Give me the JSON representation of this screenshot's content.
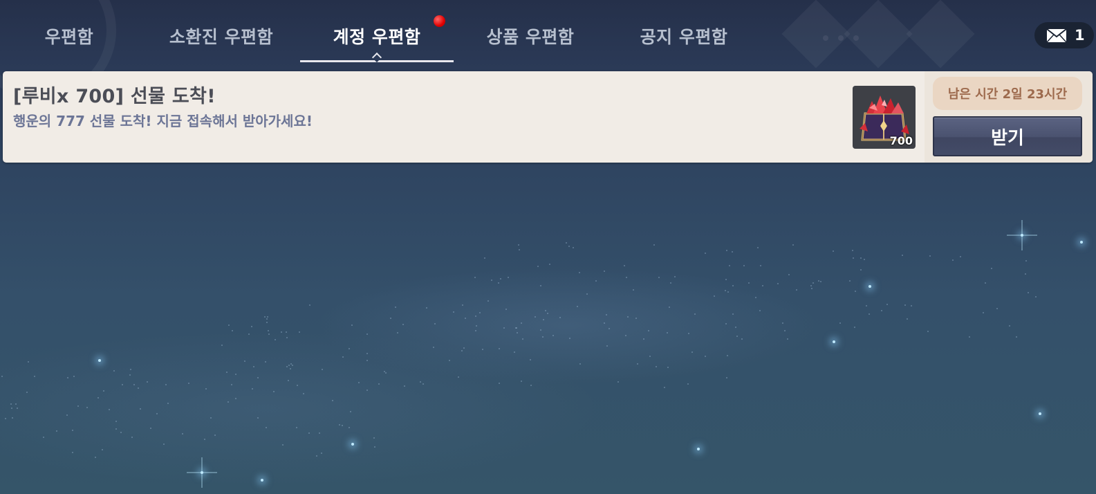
{
  "tabs": [
    {
      "label": "우편함",
      "active": false
    },
    {
      "label": "소환진 우편함",
      "active": false
    },
    {
      "label": "계정 우편함",
      "active": true,
      "has_notification": true
    },
    {
      "label": "상품 우편함",
      "active": false
    },
    {
      "label": "공지 우편함",
      "active": false
    }
  ],
  "mail_counter": {
    "icon": "envelope-icon",
    "count": "1"
  },
  "mail_items": [
    {
      "title": "[루비x 700] 선물 도착!",
      "body": "행운의 777 선물 도착! 지금 접속해서 받아가세요!",
      "reward": {
        "icon": "ruby-chest-icon",
        "count": "700"
      },
      "time_remaining": "남은 시간 2일 23시간",
      "claim_label": "받기"
    }
  ],
  "colors": {
    "notification_dot": "#e10000",
    "claim_button": "#4a526f",
    "time_badge_text": "#9d6a4d"
  }
}
